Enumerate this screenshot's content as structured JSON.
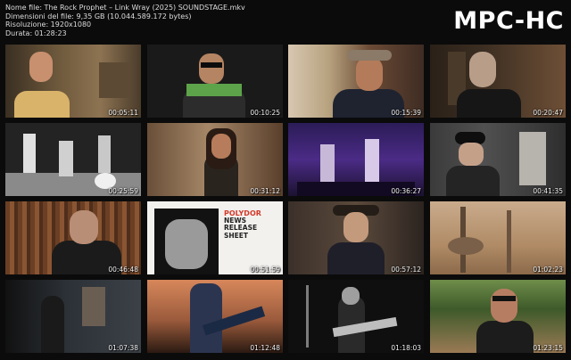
{
  "header": {
    "file_line": "Nome file: The Rock Prophet – Link Wray (2025) SOUNDSTAGE.mkv",
    "size_line": "Dimensioni del file: 9,35 GB (10.044.589.172 bytes)",
    "resolution_line": "Risoluzione: 1920x1080",
    "duration_line": "Durata: 01:28:23",
    "logo": "MPC-HC"
  },
  "thumbnails": [
    {
      "time": "00:05:11"
    },
    {
      "time": "00:10:25"
    },
    {
      "time": "00:15:39"
    },
    {
      "time": "00:20:47"
    },
    {
      "time": "00:25:59"
    },
    {
      "time": "00:31:12"
    },
    {
      "time": "00:36:27"
    },
    {
      "time": "00:41:35"
    },
    {
      "time": "00:46:48"
    },
    {
      "time": "00:51:59",
      "poster": {
        "brand": "POLYDOR",
        "line1": "NEWS",
        "line2": "RELEASE",
        "line3": "SHEET"
      }
    },
    {
      "time": "00:57:12"
    },
    {
      "time": "01:02:23"
    },
    {
      "time": "01:07:38"
    },
    {
      "time": "01:12:48"
    },
    {
      "time": "01:18:03"
    },
    {
      "time": "01:23:15"
    }
  ]
}
